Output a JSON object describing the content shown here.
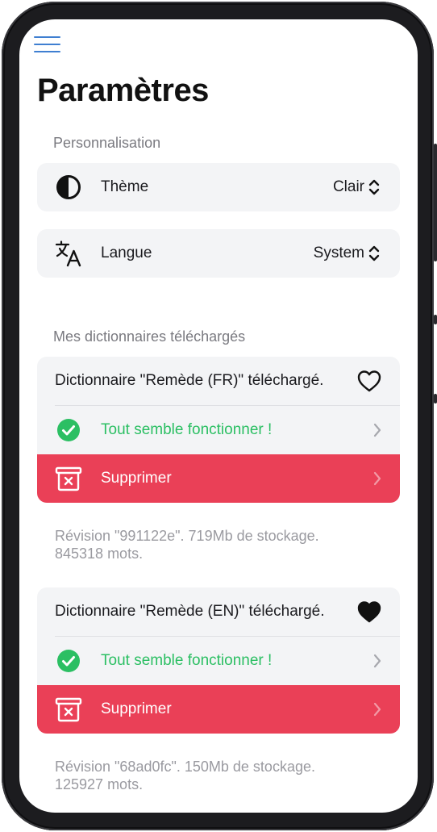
{
  "header": {
    "title": "Paramètres"
  },
  "personalisation": {
    "section_label": "Personnalisation",
    "theme": {
      "label": "Thème",
      "value": "Clair",
      "icon": "contrast-icon"
    },
    "language": {
      "label": "Langue",
      "value": "System",
      "icon": "translate-icon"
    }
  },
  "dictionaries": {
    "section_label": "Mes dictionnaires téléchargés",
    "items": [
      {
        "title": "Dictionnaire \"Remède (FR)\" téléchargé.",
        "favorite": false,
        "status": "Tout semble fonctionner !",
        "delete_label": "Supprimer",
        "revision_line1": "Révision \"991122e\". 719Mb de stockage.",
        "revision_line2": "845318 mots."
      },
      {
        "title": "Dictionnaire \"Remède (EN)\" téléchargé.",
        "favorite": true,
        "status": "Tout semble fonctionner !",
        "delete_label": "Supprimer",
        "revision_line1": "Révision \"68ad0fc\". 150Mb de stockage.",
        "revision_line2": "125927 mots."
      }
    ]
  },
  "colors": {
    "accent": "#3f7fd1",
    "success": "#2bbf63",
    "danger": "#ea4057",
    "card_bg": "#f3f4f6"
  }
}
